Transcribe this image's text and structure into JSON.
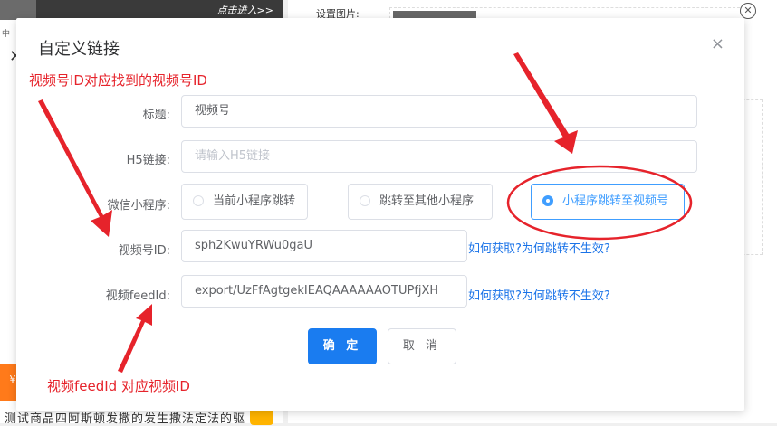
{
  "background": {
    "banner_link": "点击进入>>",
    "left_small": "中",
    "left_close": "✕",
    "orange_badge": "¥",
    "bottom_text": "测试商品四阿斯顿发撒的发生撒法定法的驱",
    "right_label": "设置图片:",
    "right_close": "✕"
  },
  "dialog": {
    "title": "自定义链接",
    "close_icon": "×",
    "fields": {
      "title_label": "标题:",
      "title_value": "视频号",
      "h5_label": "H5链接:",
      "h5_placeholder": "请输入H5链接",
      "mini_label": "微信小程序:",
      "radio_options": [
        "当前小程序跳转",
        "跳转至其他小程序",
        "小程序跳转至视频号"
      ],
      "radio_selected": 2,
      "channel_id_label": "视频号ID:",
      "channel_id_value": "sph2KwuYRWu0gaU",
      "feed_id_label": "视频feedId:",
      "feed_id_value": "export/UzFfAgtgekIEAQAAAAAAOTUPfjXH",
      "help_link_1": "如何获取?为何跳转不生效?",
      "help_link_2": "如何获取?为何跳转不生效?"
    },
    "buttons": {
      "confirm": "确 定",
      "cancel": "取 消"
    }
  },
  "annotations": {
    "top": "视频号ID对应找到的视频号ID",
    "bottom": "视频feedId 对应视频ID"
  },
  "colors": {
    "primary": "#1a7cf0",
    "annotation": "#e6232b",
    "link": "#1a73e8"
  }
}
